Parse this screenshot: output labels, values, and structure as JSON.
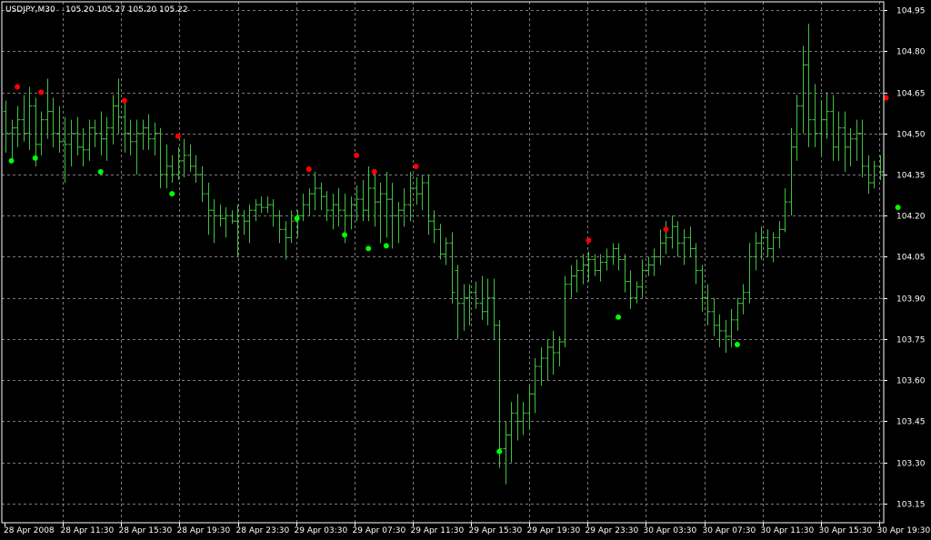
{
  "header": {
    "symbol": "USDJPY,M30",
    "quote": "105.20 105.27 105.20 105.22"
  },
  "colors": {
    "background": "#000000",
    "grid": "#7a7a7a",
    "frame": "#ffffff",
    "bar": "#40c040",
    "signal_up": "#00ff00",
    "signal_down": "#ff0000",
    "text": "#ffffff"
  },
  "chart_data": {
    "type": "ohlc",
    "title": "USDJPY,M30",
    "ylim": [
      103.08,
      104.98
    ],
    "yticks": [
      104.95,
      104.8,
      104.65,
      104.5,
      104.35,
      104.2,
      104.05,
      103.9,
      103.75,
      103.6,
      103.45,
      103.3,
      103.15
    ],
    "ytick_labels": [
      "104.95",
      "104.80",
      "104.65",
      "104.50",
      "104.35",
      "104.20",
      "104.05",
      "103.90",
      "103.75",
      "103.60",
      "103.45",
      "103.30",
      "103.15"
    ],
    "xtick_labels": [
      "28 Apr 2008",
      "28 Apr 11:30",
      "28 Apr 15:30",
      "28 Apr 19:30",
      "28 Apr 23:30",
      "29 Apr 03:30",
      "29 Apr 07:30",
      "29 Apr 11:30",
      "29 Apr 15:30",
      "29 Apr 19:30",
      "29 Apr 23:30",
      "30 Apr 03:30",
      "30 Apr 07:30",
      "30 Apr 11:30",
      "30 Apr 15:30",
      "30 Apr 19:30"
    ],
    "grid": true,
    "bars": [
      [
        104.58,
        104.62,
        104.43,
        104.5
      ],
      [
        104.5,
        104.55,
        104.4,
        104.52
      ],
      [
        104.52,
        104.6,
        104.45,
        104.55
      ],
      [
        104.55,
        104.64,
        104.47,
        104.5
      ],
      [
        104.5,
        104.67,
        104.44,
        104.6
      ],
      [
        104.6,
        104.63,
        104.38,
        104.46
      ],
      [
        104.46,
        104.58,
        104.42,
        104.55
      ],
      [
        104.55,
        104.7,
        104.48,
        104.58
      ],
      [
        104.58,
        104.63,
        104.45,
        104.5
      ],
      [
        104.5,
        104.6,
        104.43,
        104.47
      ],
      [
        104.47,
        104.56,
        104.32,
        104.46
      ],
      [
        104.46,
        104.55,
        104.38,
        104.5
      ],
      [
        104.5,
        104.56,
        104.42,
        104.45
      ],
      [
        104.45,
        104.52,
        104.38,
        104.44
      ],
      [
        104.44,
        104.55,
        104.4,
        104.52
      ],
      [
        104.52,
        104.55,
        104.45,
        104.5
      ],
      [
        104.5,
        104.58,
        104.42,
        104.48
      ],
      [
        104.48,
        104.56,
        104.4,
        104.52
      ],
      [
        104.52,
        104.64,
        104.46,
        104.6
      ],
      [
        104.6,
        104.7,
        104.5,
        104.56
      ],
      [
        104.56,
        104.62,
        104.43,
        104.5
      ],
      [
        104.5,
        104.55,
        104.42,
        104.47
      ],
      [
        104.47,
        104.55,
        104.35,
        104.5
      ],
      [
        104.5,
        104.55,
        104.44,
        104.52
      ],
      [
        104.52,
        104.57,
        104.44,
        104.48
      ],
      [
        104.48,
        104.54,
        104.42,
        104.5
      ],
      [
        104.5,
        104.52,
        104.3,
        104.35
      ],
      [
        104.35,
        104.46,
        104.3,
        104.38
      ],
      [
        104.38,
        104.42,
        104.32,
        104.35
      ],
      [
        104.35,
        104.45,
        104.33,
        104.4
      ],
      [
        104.4,
        104.48,
        104.34,
        104.42
      ],
      [
        104.42,
        104.46,
        104.36,
        104.38
      ],
      [
        104.38,
        104.42,
        104.32,
        104.35
      ],
      [
        104.35,
        104.38,
        104.25,
        104.28
      ],
      [
        104.28,
        104.32,
        104.13,
        104.22
      ],
      [
        104.22,
        104.26,
        104.1,
        104.2
      ],
      [
        104.2,
        104.24,
        104.16,
        104.19
      ],
      [
        104.19,
        104.23,
        104.12,
        104.2
      ],
      [
        104.2,
        104.22,
        104.17,
        104.18
      ],
      [
        104.18,
        104.24,
        104.05,
        104.2
      ],
      [
        104.2,
        104.22,
        104.13,
        104.18
      ],
      [
        104.18,
        104.24,
        104.1,
        104.22
      ],
      [
        104.22,
        104.26,
        104.18,
        104.24
      ],
      [
        104.24,
        104.27,
        104.21,
        104.23
      ],
      [
        104.23,
        104.27,
        104.21,
        104.24
      ],
      [
        104.24,
        104.26,
        104.16,
        104.2
      ],
      [
        104.2,
        104.22,
        104.1,
        104.15
      ],
      [
        104.15,
        104.18,
        104.04,
        104.12
      ],
      [
        104.12,
        104.22,
        104.1,
        104.18
      ],
      [
        104.18,
        104.22,
        104.12,
        104.2
      ],
      [
        104.2,
        104.28,
        104.18,
        104.24
      ],
      [
        104.24,
        104.3,
        104.2,
        104.28
      ],
      [
        104.28,
        104.36,
        104.22,
        104.3
      ],
      [
        104.3,
        104.32,
        104.22,
        104.27
      ],
      [
        104.27,
        104.29,
        104.18,
        104.22
      ],
      [
        104.22,
        104.28,
        104.15,
        104.24
      ],
      [
        104.24,
        104.3,
        104.16,
        104.22
      ],
      [
        104.22,
        104.28,
        104.1,
        104.2
      ],
      [
        104.2,
        104.27,
        104.15,
        104.24
      ],
      [
        104.24,
        104.31,
        104.18,
        104.26
      ],
      [
        104.26,
        104.33,
        104.18,
        104.22
      ],
      [
        104.22,
        104.38,
        104.18,
        104.3
      ],
      [
        104.3,
        104.37,
        104.16,
        104.25
      ],
      [
        104.25,
        104.32,
        104.1,
        104.28
      ],
      [
        104.28,
        104.36,
        104.12,
        104.26
      ],
      [
        104.26,
        104.32,
        104.08,
        104.2
      ],
      [
        104.2,
        104.25,
        104.1,
        104.22
      ],
      [
        104.22,
        104.3,
        104.16,
        104.24
      ],
      [
        104.24,
        104.36,
        104.18,
        104.3
      ],
      [
        104.3,
        104.34,
        104.24,
        104.28
      ],
      [
        104.28,
        104.35,
        104.22,
        104.32
      ],
      [
        104.32,
        104.35,
        104.13,
        104.18
      ],
      [
        104.18,
        104.22,
        104.1,
        104.15
      ],
      [
        104.15,
        104.17,
        104.04,
        104.06
      ],
      [
        104.06,
        104.12,
        104.02,
        104.1
      ],
      [
        104.1,
        104.14,
        103.88,
        103.92
      ],
      [
        104.0,
        104.02,
        103.75,
        103.88
      ],
      [
        103.88,
        103.95,
        103.78,
        103.9
      ],
      [
        103.9,
        103.95,
        103.8,
        103.92
      ],
      [
        103.92,
        103.96,
        103.86,
        103.88
      ],
      [
        103.88,
        103.98,
        103.82,
        103.85
      ],
      [
        103.85,
        103.97,
        103.8,
        103.9
      ],
      [
        103.9,
        103.97,
        103.75,
        103.8
      ],
      [
        103.8,
        103.82,
        103.28,
        103.35
      ],
      [
        103.35,
        103.45,
        103.22,
        103.4
      ],
      [
        103.4,
        103.52,
        103.3,
        103.48
      ],
      [
        103.48,
        103.55,
        103.38,
        103.45
      ],
      [
        103.45,
        103.52,
        103.4,
        103.48
      ],
      [
        103.48,
        103.58,
        103.42,
        103.55
      ],
      [
        103.55,
        103.68,
        103.48,
        103.65
      ],
      [
        103.65,
        103.72,
        103.58,
        103.68
      ],
      [
        103.68,
        103.75,
        103.6,
        103.72
      ],
      [
        103.72,
        103.78,
        103.62,
        103.7
      ],
      [
        103.7,
        103.76,
        103.65,
        103.74
      ],
      [
        103.74,
        103.98,
        103.72,
        103.95
      ],
      [
        103.95,
        104.02,
        103.9,
        103.98
      ],
      [
        103.98,
        104.04,
        103.92,
        104.0
      ],
      [
        104.0,
        104.06,
        103.95,
        104.02
      ],
      [
        104.02,
        104.07,
        103.96,
        104.04
      ],
      [
        104.04,
        104.06,
        103.98,
        104.0
      ],
      [
        104.0,
        104.06,
        103.96,
        104.03
      ],
      [
        104.03,
        104.08,
        104.0,
        104.05
      ],
      [
        104.05,
        104.1,
        104.02,
        104.08
      ],
      [
        104.08,
        104.1,
        104.0,
        104.04
      ],
      [
        104.04,
        104.06,
        103.92,
        103.96
      ],
      [
        103.96,
        104.0,
        103.86,
        103.9
      ],
      [
        103.9,
        103.96,
        103.88,
        103.94
      ],
      [
        103.94,
        104.04,
        103.9,
        104.0
      ],
      [
        104.0,
        104.05,
        103.98,
        104.02
      ],
      [
        104.02,
        104.08,
        103.98,
        104.05
      ],
      [
        104.05,
        104.15,
        104.02,
        104.1
      ],
      [
        104.1,
        104.18,
        104.06,
        104.12
      ],
      [
        104.12,
        104.2,
        104.08,
        104.16
      ],
      [
        104.16,
        104.18,
        104.05,
        104.1
      ],
      [
        104.1,
        104.15,
        104.02,
        104.12
      ],
      [
        104.12,
        104.16,
        104.05,
        104.08
      ],
      [
        104.08,
        104.1,
        103.95,
        104.0
      ],
      [
        104.0,
        104.02,
        103.85,
        103.9
      ],
      [
        103.9,
        103.95,
        103.8,
        103.85
      ],
      [
        103.85,
        103.9,
        103.76,
        103.8
      ],
      [
        103.8,
        103.84,
        103.72,
        103.78
      ],
      [
        103.78,
        103.82,
        103.7,
        103.76
      ],
      [
        103.76,
        103.86,
        103.72,
        103.82
      ],
      [
        103.82,
        103.9,
        103.78,
        103.88
      ],
      [
        103.88,
        103.95,
        103.84,
        103.92
      ],
      [
        103.92,
        104.1,
        103.88,
        104.05
      ],
      [
        104.05,
        104.14,
        104.0,
        104.1
      ],
      [
        104.1,
        104.16,
        104.04,
        104.12
      ],
      [
        104.12,
        104.15,
        104.05,
        104.08
      ],
      [
        104.08,
        104.14,
        104.03,
        104.12
      ],
      [
        104.12,
        104.18,
        104.08,
        104.15
      ],
      [
        104.15,
        104.3,
        104.14,
        104.25
      ],
      [
        104.25,
        104.52,
        104.2,
        104.45
      ],
      [
        104.45,
        104.64,
        104.4,
        104.6
      ],
      [
        104.6,
        104.82,
        104.5,
        104.75
      ],
      [
        104.75,
        104.9,
        104.45,
        104.55
      ],
      [
        104.55,
        104.68,
        104.45,
        104.5
      ],
      [
        104.5,
        104.62,
        104.42,
        104.55
      ],
      [
        104.55,
        104.65,
        104.48,
        104.58
      ],
      [
        104.58,
        104.64,
        104.4,
        104.45
      ],
      [
        104.45,
        104.58,
        104.4,
        104.52
      ],
      [
        104.52,
        104.58,
        104.36,
        104.45
      ],
      [
        104.45,
        104.52,
        104.38,
        104.48
      ],
      [
        104.48,
        104.55,
        104.4,
        104.5
      ],
      [
        104.5,
        104.55,
        104.34,
        104.38
      ],
      [
        104.38,
        104.42,
        104.28,
        104.32
      ],
      [
        104.32,
        104.4,
        104.3,
        104.38
      ],
      [
        104.38,
        104.42,
        104.33,
        104.36
      ]
    ],
    "signals_up": [
      [
        1,
        104.4
      ],
      [
        5,
        104.41
      ],
      [
        16,
        104.36
      ],
      [
        28,
        104.28
      ],
      [
        49,
        104.19
      ],
      [
        57,
        104.13
      ],
      [
        61,
        104.08
      ],
      [
        64,
        104.09
      ],
      [
        83,
        103.34
      ],
      [
        103,
        103.83
      ],
      [
        123,
        103.73
      ],
      [
        150,
        104.23
      ]
    ],
    "signals_down": [
      [
        2,
        104.67
      ],
      [
        6,
        104.65
      ],
      [
        20,
        104.62
      ],
      [
        29,
        104.49
      ],
      [
        51,
        104.37
      ],
      [
        59,
        104.42
      ],
      [
        62,
        104.36
      ],
      [
        69,
        104.38
      ],
      [
        98,
        104.11
      ],
      [
        111,
        104.15
      ],
      [
        148,
        104.63
      ]
    ]
  }
}
